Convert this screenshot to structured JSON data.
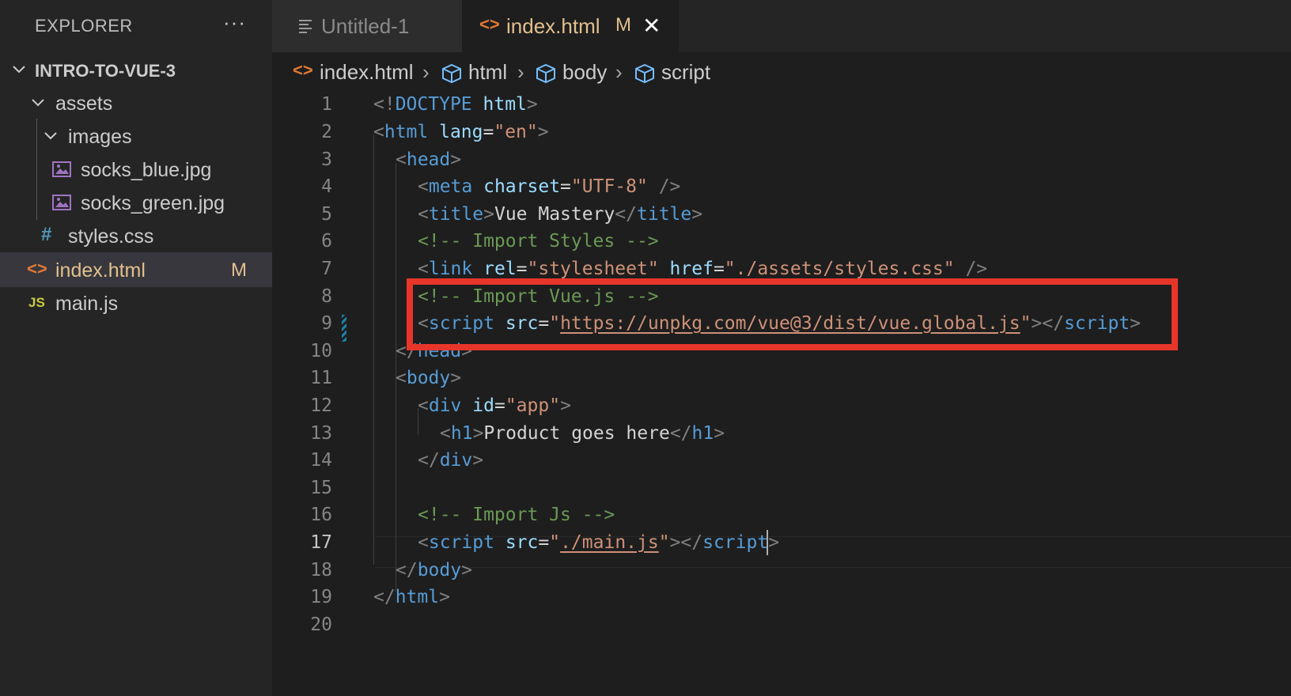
{
  "sidebar": {
    "title": "EXPLORER",
    "more_label": "···",
    "tree": {
      "root": "INTRO-TO-VUE-3",
      "assets": "assets",
      "images": "images",
      "file1": "socks_blue.jpg",
      "file2": "socks_green.jpg",
      "styles": "styles.css",
      "index": "index.html",
      "index_status": "M",
      "main": "main.js"
    }
  },
  "tabs": {
    "untitled": "Untitled-1",
    "active": "index.html",
    "active_status": "M",
    "close": "✕"
  },
  "breadcrumb": {
    "file": "index.html",
    "html": "html",
    "body": "body",
    "script": "script",
    "sep": "›"
  },
  "editor": {
    "line_numbers": [
      "1",
      "2",
      "3",
      "4",
      "5",
      "6",
      "7",
      "8",
      "9",
      "10",
      "11",
      "12",
      "13",
      "14",
      "15",
      "16",
      "17",
      "18",
      "19",
      "20"
    ],
    "current_line": 17,
    "l1": {
      "a": "<!",
      "b": "DOCTYPE",
      "c": " ",
      "d": "html",
      "e": ">"
    },
    "l2": {
      "a": "<",
      "b": "html",
      "c": " ",
      "d": "lang",
      "e": "=",
      "f": "\"en\"",
      "g": ">"
    },
    "l3": {
      "a": "<",
      "b": "head",
      "c": ">"
    },
    "l4": {
      "a": "<",
      "b": "meta",
      "c": " ",
      "d": "charset",
      "e": "=",
      "f": "\"UTF-8\"",
      "g": " />"
    },
    "l5": {
      "a": "<",
      "b": "title",
      "c": ">",
      "d": "Vue Mastery",
      "e": "</",
      "f": "title",
      "g": ">"
    },
    "l6": "<!-- Import Styles -->",
    "l7": {
      "a": "<",
      "b": "link",
      "c": " ",
      "d": "rel",
      "e": "=",
      "f": "\"stylesheet\"",
      "g": " ",
      "h": "href",
      "i": "=",
      "j": "\"./assets/styles.css\"",
      "k": " />"
    },
    "l8": "<!-- Import Vue.js -->",
    "l9": {
      "a": "<",
      "b": "script",
      "c": " ",
      "d": "src",
      "e": "=",
      "f1": "\"",
      "f2": "https://unpkg.com/vue@3/dist/vue.global.js",
      "f3": "\"",
      "g": "></",
      "h": "script",
      "i": ">"
    },
    "l10": {
      "a": "</",
      "b": "head",
      "c": ">"
    },
    "l11": {
      "a": "<",
      "b": "body",
      "c": ">"
    },
    "l12": {
      "a": "<",
      "b": "div",
      "c": " ",
      "d": "id",
      "e": "=",
      "f": "\"app\"",
      "g": ">"
    },
    "l13": {
      "a": "<",
      "b": "h1",
      "c": ">",
      "d": "Product goes here",
      "e": "</",
      "f": "h1",
      "g": ">"
    },
    "l14": {
      "a": "</",
      "b": "div",
      "c": ">"
    },
    "l16": "<!-- Import Js -->",
    "l17": {
      "a": "<",
      "b": "script",
      "c": " ",
      "d": "src",
      "e": "=",
      "f1": "\"",
      "f2": "./main.js",
      "f3": "\"",
      "g": "></",
      "h": "script",
      "i": ">"
    },
    "l18": {
      "a": "</",
      "b": "body",
      "c": ">"
    },
    "l19": {
      "a": "</",
      "b": "html",
      "c": ">"
    }
  },
  "colors": {
    "highlight_box": "#e8352a",
    "modified": "#e2c08d",
    "tag": "#569cd6",
    "attribute": "#9cdcfe",
    "string": "#ce9178",
    "comment": "#6a9955"
  }
}
